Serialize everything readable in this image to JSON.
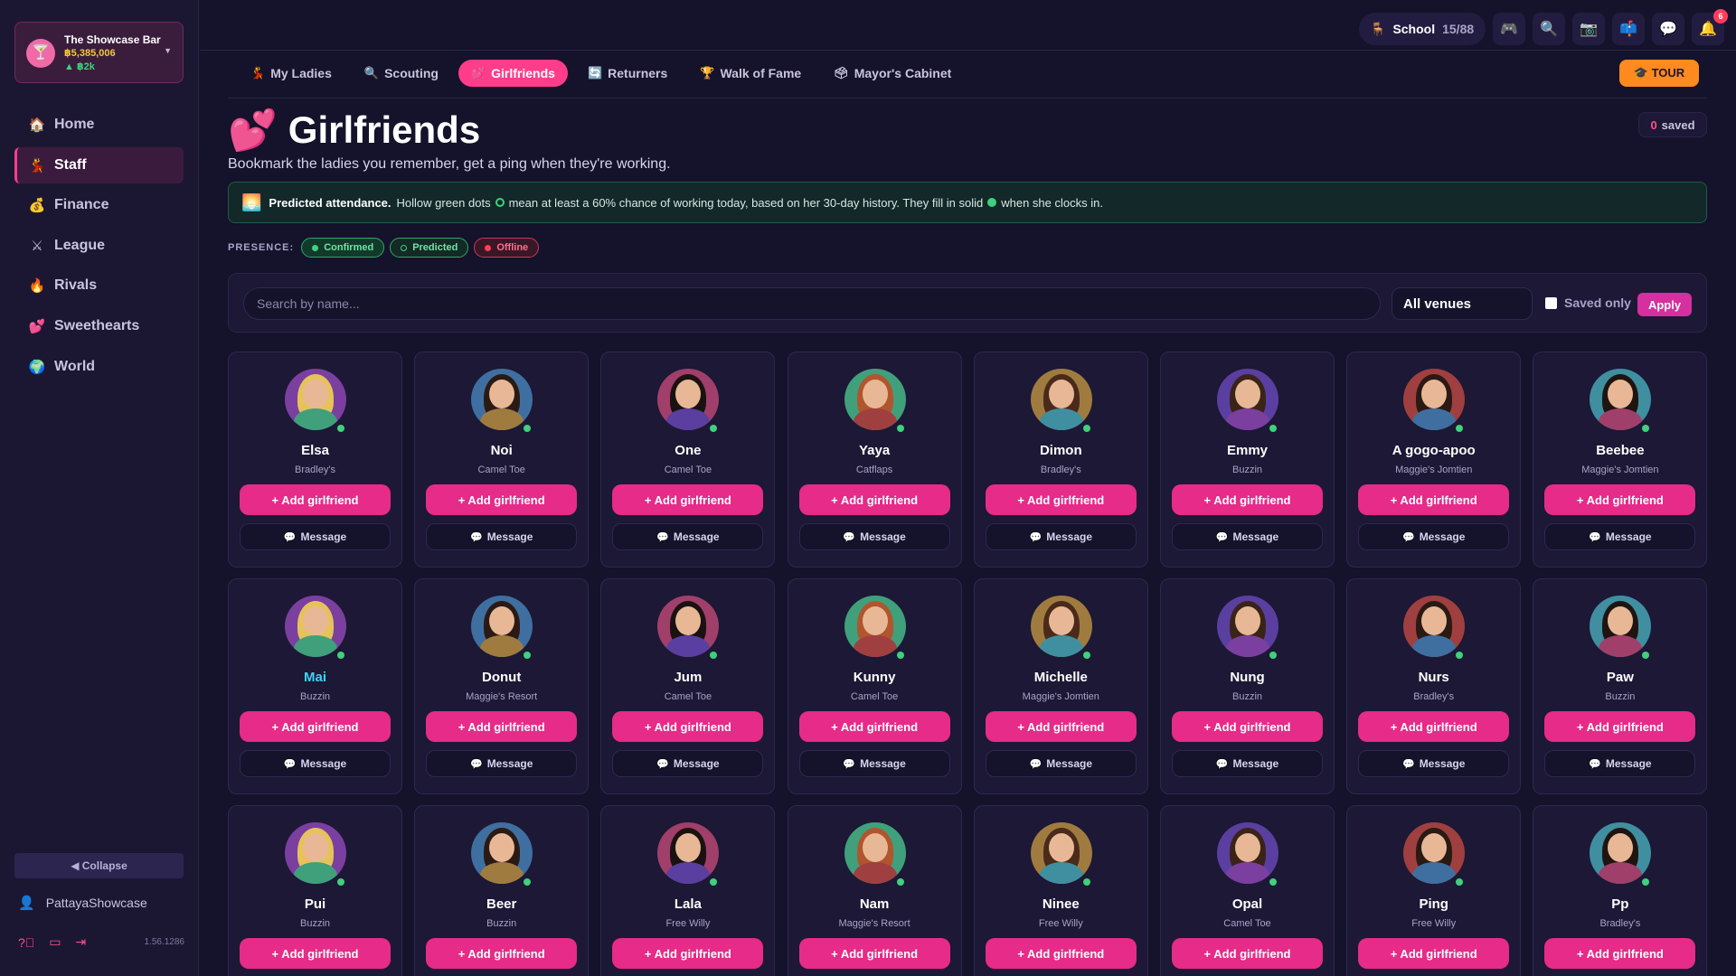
{
  "bar": {
    "name": "The Showcase Bar",
    "money": "฿5,385,006",
    "delta": "▲ ฿2k",
    "logo_icon": "cocktail-icon"
  },
  "nav": [
    {
      "label": "Home",
      "icon": "🏠",
      "active": false
    },
    {
      "label": "Staff",
      "icon": "💃",
      "active": true
    },
    {
      "label": "Finance",
      "icon": "💰",
      "active": false
    },
    {
      "label": "League",
      "icon": "⚔",
      "active": false
    },
    {
      "label": "Rivals",
      "icon": "🔥",
      "active": false
    },
    {
      "label": "Sweethearts",
      "icon": "💕",
      "active": false
    },
    {
      "label": "World",
      "icon": "🌍",
      "active": false
    }
  ],
  "sidebar_footer": {
    "collapse_label": "◀ Collapse",
    "username": "PattayaShowcase",
    "version": "1.56.1286"
  },
  "topbar": {
    "school_label": "School",
    "school_count": "15/88",
    "notif_count": "6"
  },
  "tabs": [
    {
      "label": "My Ladies",
      "icon": "💃",
      "active": false
    },
    {
      "label": "Scouting",
      "icon": "🔍",
      "active": false
    },
    {
      "label": "Girlfriends",
      "icon": "💕",
      "active": true
    },
    {
      "label": "Returners",
      "icon": "🔄",
      "active": false
    },
    {
      "label": "Walk of Fame",
      "icon": "🏆",
      "active": false
    },
    {
      "label": "Mayor's Cabinet",
      "icon": "🗳",
      "active": false
    }
  ],
  "tour_label": "🎓 TOUR",
  "header": {
    "title": "Girlfriends",
    "saved_count": "0",
    "saved_label": "saved",
    "subtitle": "Bookmark the ladies you remember, get a ping when they're working."
  },
  "info": {
    "bold": "Predicted attendance.",
    "text_a": "Hollow green dots",
    "text_b": "mean at least a 60% chance of working today, based on her 30-day history. They fill in solid",
    "text_c": "when she clocks in."
  },
  "presence": {
    "label": "PRESENCE:",
    "confirmed": "Confirmed",
    "predicted": "Predicted",
    "offline": "Offline"
  },
  "filters": {
    "search_placeholder": "Search by name...",
    "venue": "All venues",
    "saved_only": "Saved only",
    "apply": "Apply"
  },
  "card_labels": {
    "add": "+ Add girlfriend",
    "message": "Message"
  },
  "cards": [
    {
      "name": "Elsa",
      "venue": "Bradley's"
    },
    {
      "name": "Noi",
      "venue": "Camel Toe"
    },
    {
      "name": "One",
      "venue": "Camel Toe"
    },
    {
      "name": "Yaya",
      "venue": "Catflaps"
    },
    {
      "name": "Dimon",
      "venue": "Bradley's"
    },
    {
      "name": "Emmy",
      "venue": "Buzzin"
    },
    {
      "name": "A gogo-apoo",
      "venue": "Maggie's Jomtien"
    },
    {
      "name": "Beebee",
      "venue": "Maggie's Jomtien"
    },
    {
      "name": "Mai",
      "venue": "Buzzin"
    },
    {
      "name": "Donut",
      "venue": "Maggie's Resort"
    },
    {
      "name": "Jum",
      "venue": "Camel Toe"
    },
    {
      "name": "Kunny",
      "venue": "Camel Toe"
    },
    {
      "name": "Michelle",
      "venue": "Maggie's Jomtien"
    },
    {
      "name": "Nung",
      "venue": "Buzzin"
    },
    {
      "name": "Nurs",
      "venue": "Bradley's"
    },
    {
      "name": "Paw",
      "venue": "Buzzin"
    },
    {
      "name": "Pui",
      "venue": "Buzzin"
    },
    {
      "name": "Beer",
      "venue": "Buzzin"
    },
    {
      "name": "Lala",
      "venue": "Free Willy"
    },
    {
      "name": "Nam",
      "venue": "Maggie's Resort"
    },
    {
      "name": "Ninee",
      "venue": "Free Willy"
    },
    {
      "name": "Opal",
      "venue": "Camel Toe"
    },
    {
      "name": "Ping",
      "venue": "Free Willy"
    },
    {
      "name": "Pp",
      "venue": "Bradley's"
    }
  ]
}
